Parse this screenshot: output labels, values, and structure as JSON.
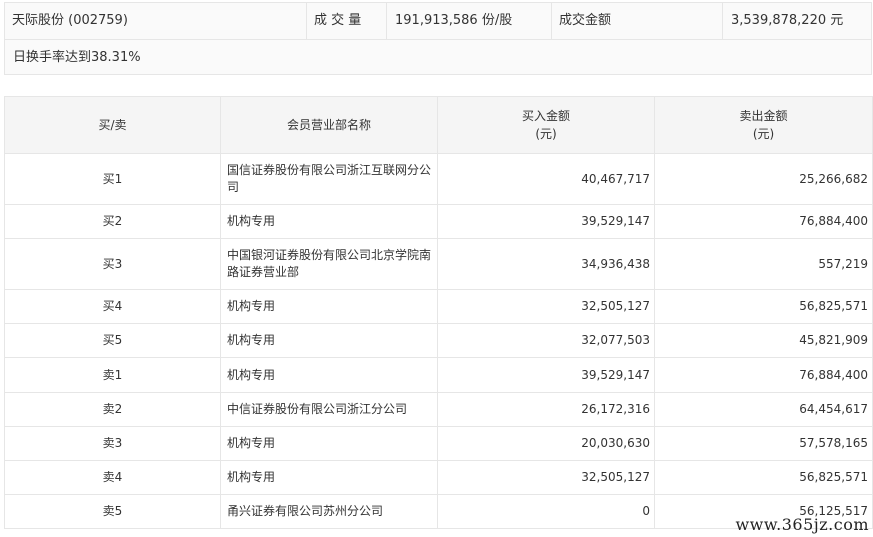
{
  "summary": {
    "stock": "天际股份 (002759)",
    "volume_label": "成 交 量",
    "volume_value": "191,913,586 份/股",
    "amount_label": "成交金额",
    "amount_value": "3,539,878,220 元",
    "turnover_note": "日换手率达到38.31%"
  },
  "table": {
    "headers": {
      "side": "买/卖",
      "branch": "会员营业部名称",
      "buy_line1": "买入金额",
      "buy_line2": "(元)",
      "sell_line1": "卖出金额",
      "sell_line2": "(元)"
    },
    "rows": [
      {
        "side": "买1",
        "branch": "国信证券股份有限公司浙江互联网分公司",
        "buy": "40,467,717",
        "sell": "25,266,682"
      },
      {
        "side": "买2",
        "branch": "机构专用",
        "buy": "39,529,147",
        "sell": "76,884,400"
      },
      {
        "side": "买3",
        "branch": "中国银河证券股份有限公司北京学院南路证券营业部",
        "buy": "34,936,438",
        "sell": "557,219"
      },
      {
        "side": "买4",
        "branch": "机构专用",
        "buy": "32,505,127",
        "sell": "56,825,571"
      },
      {
        "side": "买5",
        "branch": "机构专用",
        "buy": "32,077,503",
        "sell": "45,821,909"
      },
      {
        "side": "卖1",
        "branch": "机构专用",
        "buy": "39,529,147",
        "sell": "76,884,400"
      },
      {
        "side": "卖2",
        "branch": "中信证券股份有限公司浙江分公司",
        "buy": "26,172,316",
        "sell": "64,454,617"
      },
      {
        "side": "卖3",
        "branch": "机构专用",
        "buy": "20,030,630",
        "sell": "57,578,165"
      },
      {
        "side": "卖4",
        "branch": "机构专用",
        "buy": "32,505,127",
        "sell": "56,825,571"
      },
      {
        "side": "卖5",
        "branch": "甬兴证券有限公司苏州分公司",
        "buy": "0",
        "sell": "56,125,517"
      }
    ]
  },
  "watermark": "www.365jz.com"
}
